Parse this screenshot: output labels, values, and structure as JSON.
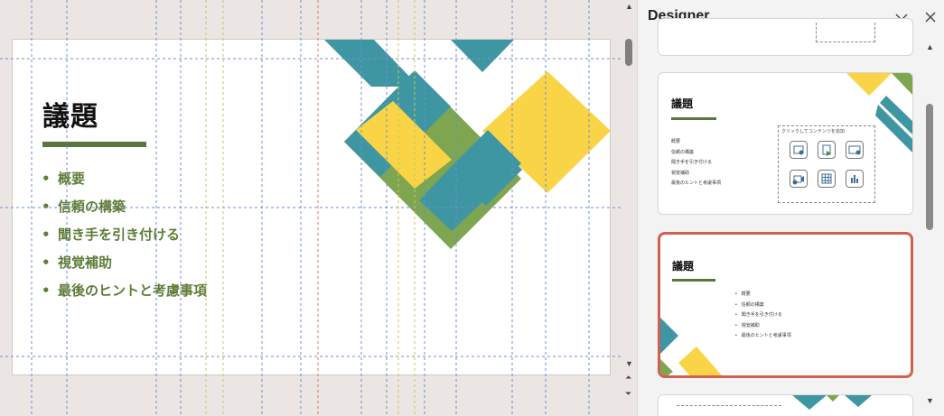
{
  "slide": {
    "title": "議題",
    "bullets": [
      "概要",
      "信頼の構築",
      "聞き手を引き付ける",
      "視覚補助",
      "最後のヒントと考慮事項"
    ]
  },
  "designer": {
    "title": "Designer",
    "collapse_icon": "chevron-down-icon",
    "close_icon": "close-icon",
    "cards": [
      {
        "title": "議題",
        "bullets": [
          "概要",
          "信頼の構築",
          "聞き手を引き付ける",
          "視覚補助",
          "最後のヒントと考慮事項"
        ],
        "placeholder_label": "クリックしてコンテンツを追加",
        "placeholder_icons": [
          "picture-icon",
          "icon-insert-icon",
          "stock-image-icon",
          "video-icon",
          "table-icon",
          "chart-icon"
        ]
      },
      {
        "title": "議題",
        "bullets": [
          "概要",
          "信頼の構築",
          "聞き手を引き付ける",
          "視覚補助",
          "最後のヒントと考慮事項"
        ]
      }
    ]
  },
  "colors": {
    "teal": "#3f96a3",
    "green": "#7ea550",
    "dark_green": "#58773a",
    "yellow": "#f9d447",
    "bullet_green": "#5e7d37",
    "selection": "#d0604f",
    "canvas_bg": "#ebe6e3"
  }
}
